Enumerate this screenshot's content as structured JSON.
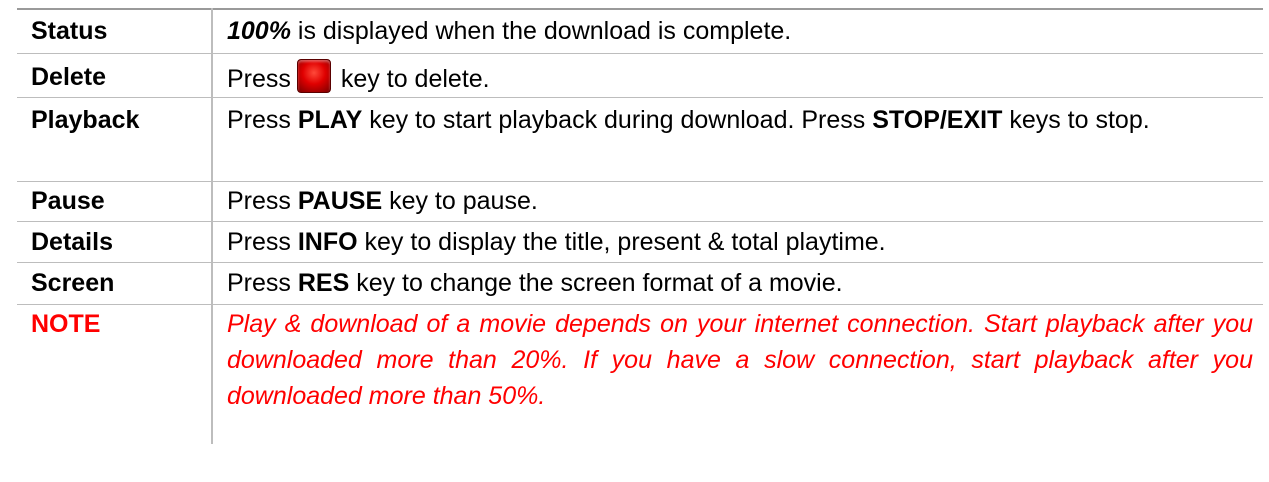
{
  "rows": [
    {
      "label": "Status",
      "parts": {
        "emph": "100%",
        "rest": " is displayed when the download is complete."
      }
    },
    {
      "label": "Delete",
      "parts": {
        "pre": "Press",
        "icon": "red-stop-key-icon",
        "post": "key to delete."
      }
    },
    {
      "label": "Playback",
      "parts": {
        "p1": "Press ",
        "k1": "PLAY",
        "p2": " key to start playback during download. Press ",
        "k2": "STOP/EXIT",
        "p3": " keys to stop."
      }
    },
    {
      "label": "Pause",
      "parts": {
        "p1": "Press ",
        "k1": "PAUSE",
        "p2": " key to pause."
      }
    },
    {
      "label": "Details",
      "parts": {
        "p1": "Press ",
        "k1": "INFO",
        "p2": " key to display the title, present & total playtime."
      }
    },
    {
      "label": "Screen",
      "parts": {
        "p1": "Press ",
        "k1": "RES",
        "p2": " key to change the screen format of a movie."
      }
    },
    {
      "label": "NOTE",
      "text": "Play & download of a movie depends on your internet connection. Start playback after you downloaded more than 20%. If you have a slow connection, start playback after you downloaded more than 50%."
    }
  ],
  "colors": {
    "note": "#ff0000",
    "key": "#e00000",
    "border": "#bdbdbd"
  }
}
